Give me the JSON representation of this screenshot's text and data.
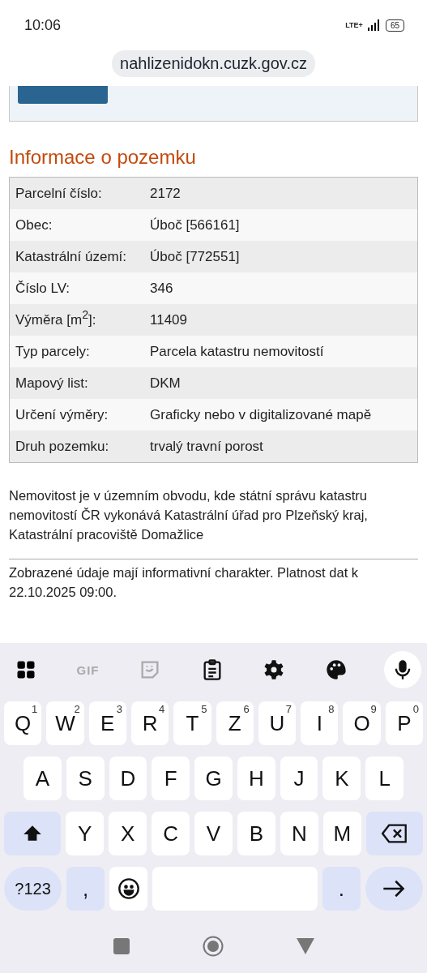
{
  "status_bar": {
    "time": "10:06",
    "network": "LTE+",
    "battery": "65"
  },
  "address_bar": {
    "url": "nahlizenidokn.cuzk.gov.cz"
  },
  "heading": "Informace o pozemku",
  "table": {
    "rows": [
      {
        "label": "Parcelní číslo:",
        "value": "2172"
      },
      {
        "label": "Obec:",
        "value": "Úboč [566161]"
      },
      {
        "label": "Katastrální území:",
        "value": "Úboč [772551]"
      },
      {
        "label": "Číslo LV:",
        "value": "346"
      },
      {
        "label": "Výměra [m$^{2}$]:",
        "value": "11409"
      },
      {
        "label": "Typ parcely:",
        "value": "Parcela katastru nemovitostí"
      },
      {
        "label": "Mapový list:",
        "value": "DKM"
      },
      {
        "label": "Určení výměry:",
        "value": "Graficky nebo v digitalizované mapě"
      },
      {
        "label": "Druh pozemku:",
        "value": "trvalý travní porost"
      }
    ]
  },
  "office_note": "Nemovitost je v územním obvodu, kde státní správu katastru nemovitostí ČR vykonává Katastrální úřad pro Plzeňský kraj, Katastrální pracoviště Domažlice",
  "disclaimer": "Zobrazené údaje mají informativní charakter. Platnost dat k 22.10.2025 09:00.",
  "keyboard": {
    "toolbar": [
      {
        "kind": "apps"
      },
      {
        "kind": "gif",
        "label": "GIF"
      },
      {
        "kind": "sticker"
      },
      {
        "kind": "clipboard"
      },
      {
        "kind": "settings"
      },
      {
        "kind": "palette"
      },
      {
        "kind": "mic"
      }
    ],
    "rows": [
      {
        "keys": [
          {
            "kind": "char",
            "label": "Q",
            "hint": "1"
          },
          {
            "kind": "char",
            "label": "W",
            "hint": "2"
          },
          {
            "kind": "char",
            "label": "E",
            "hint": "3"
          },
          {
            "kind": "char",
            "label": "R",
            "hint": "4"
          },
          {
            "kind": "char",
            "label": "T",
            "hint": "5"
          },
          {
            "kind": "char",
            "label": "Z",
            "hint": "6"
          },
          {
            "kind": "char",
            "label": "U",
            "hint": "7"
          },
          {
            "kind": "char",
            "label": "I",
            "hint": "8"
          },
          {
            "kind": "char",
            "label": "O",
            "hint": "9"
          },
          {
            "kind": "char",
            "label": "P",
            "hint": "0"
          }
        ]
      },
      {
        "keys": [
          {
            "kind": "char",
            "label": "A"
          },
          {
            "kind": "char",
            "label": "S"
          },
          {
            "kind": "char",
            "label": "D"
          },
          {
            "kind": "char",
            "label": "F"
          },
          {
            "kind": "char",
            "label": "G"
          },
          {
            "kind": "char",
            "label": "H"
          },
          {
            "kind": "char",
            "label": "J"
          },
          {
            "kind": "char",
            "label": "K"
          },
          {
            "kind": "char",
            "label": "L"
          }
        ]
      },
      {
        "keys": [
          {
            "kind": "shift"
          },
          {
            "kind": "char",
            "label": "Y"
          },
          {
            "kind": "char",
            "label": "X"
          },
          {
            "kind": "char",
            "label": "C"
          },
          {
            "kind": "char",
            "label": "V"
          },
          {
            "kind": "char",
            "label": "B"
          },
          {
            "kind": "char",
            "label": "N"
          },
          {
            "kind": "char",
            "label": "M"
          },
          {
            "kind": "backspace"
          }
        ]
      },
      {
        "keys": [
          {
            "kind": "symbols",
            "label": "?123"
          },
          {
            "kind": "punct",
            "label": ","
          },
          {
            "kind": "emoji"
          },
          {
            "kind": "space"
          },
          {
            "kind": "punct",
            "label": "."
          },
          {
            "kind": "enter"
          }
        ]
      }
    ]
  }
}
